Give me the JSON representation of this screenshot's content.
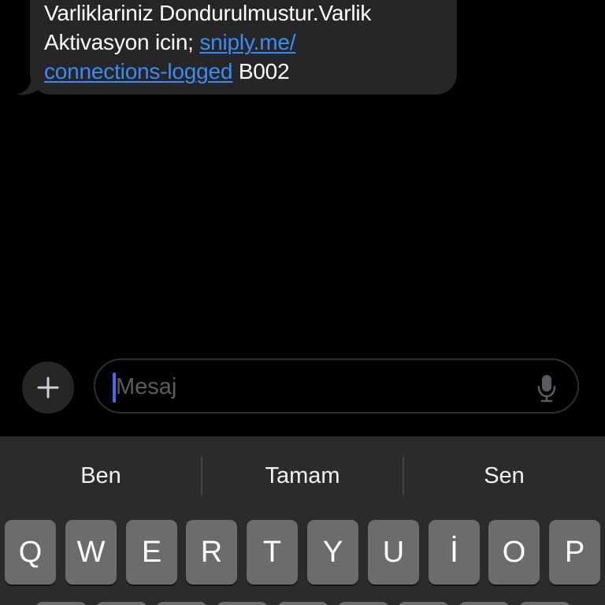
{
  "message": {
    "line1": "Varliklariniz Dondurulmustur.Varlik",
    "line2_text": "Aktivasyon icin; ",
    "link_part1": "sniply.me/",
    "link_part2": "connections-logged",
    "line3_suffix": " B002"
  },
  "compose": {
    "placeholder": "Mesaj",
    "plus_icon": "plus-icon",
    "mic_icon": "microphone-icon"
  },
  "keyboard": {
    "suggestions": [
      "Ben",
      "Tamam",
      "Sen"
    ],
    "row1": [
      "Q",
      "W",
      "E",
      "R",
      "T",
      "Y",
      "U",
      "İ",
      "O",
      "P"
    ]
  },
  "colors": {
    "background": "#000000",
    "bubble": "#262628",
    "link": "#3b8cf2",
    "caret": "#3f6ff0",
    "keyboard_bg": "#2b2b2b",
    "key": "#6c6c6e",
    "placeholder": "#5c5c60"
  }
}
